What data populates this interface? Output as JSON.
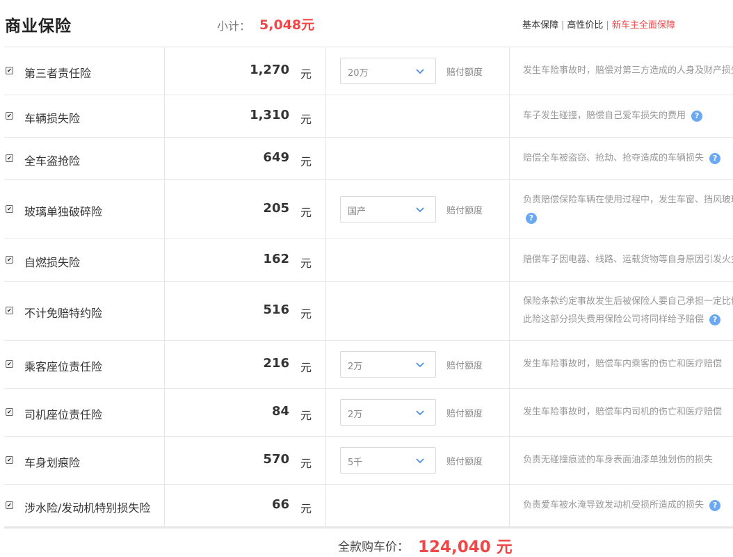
{
  "header": {
    "title": "商业保险",
    "subtotal_label": "小计：",
    "subtotal_value": "5,048元",
    "links": [
      "基本保障",
      "高性价比",
      "新车主全面保障"
    ]
  },
  "unit": "元",
  "limit_label": "赔付额度",
  "rows": [
    {
      "name": "第三者责任险",
      "price": "1,270",
      "checked": true,
      "select": "20万",
      "desc": "发生车险事故时，赔偿对第三方造成的人身及财产损失"
    },
    {
      "name": "车辆损失险",
      "price": "1,310",
      "checked": true,
      "desc": "车子发生碰撞，赔偿自己爱车损失的费用"
    },
    {
      "name": "全车盗抢险",
      "price": "649",
      "checked": true,
      "desc": "赔偿全车被盗窃、抢劫、抢夺造成的车辆损失"
    },
    {
      "name": "玻璃单独破碎险",
      "price": "205",
      "checked": true,
      "select": "国产",
      "desc": "负责赔偿保险车辆在使用过程中，发生车窗、挡风玻璃单独破碎"
    },
    {
      "name": "自燃损失险",
      "price": "162",
      "checked": true,
      "desc": "赔偿车子因电器、线路、运载货物等自身原因引发火灾"
    },
    {
      "name": "不计免赔特约险",
      "price": "516",
      "checked": true,
      "desc": "保险条款约定事故发生后被保险人要自己承担一定比例的损失",
      "desc2": "此险这部分损失费用保险公司将同样给予赔偿"
    },
    {
      "name": "乘客座位责任险",
      "price": "216",
      "checked": true,
      "select": "2万",
      "desc": "发生车险事故时，赔偿车内乘客的伤亡和医疗赔偿"
    },
    {
      "name": "司机座位责任险",
      "price": "84",
      "checked": true,
      "select": "2万",
      "desc": "发生车险事故时，赔偿车内司机的伤亡和医疗赔偿"
    },
    {
      "name": "车身划痕险",
      "price": "570",
      "checked": true,
      "select": "5千",
      "desc": "负责无碰撞痕迹的车身表面油漆单独划伤的损失"
    },
    {
      "name": "涉水险/发动机特别损失险",
      "price": "66",
      "checked": true,
      "desc": "负责爱车被水淹导致发动机受损所造成的损失"
    }
  ],
  "footer": {
    "total_label": "全款购车价：",
    "total_value": "124,040 元"
  },
  "colors": {
    "accent": "#f04848",
    "help": "#6aa9f1"
  }
}
